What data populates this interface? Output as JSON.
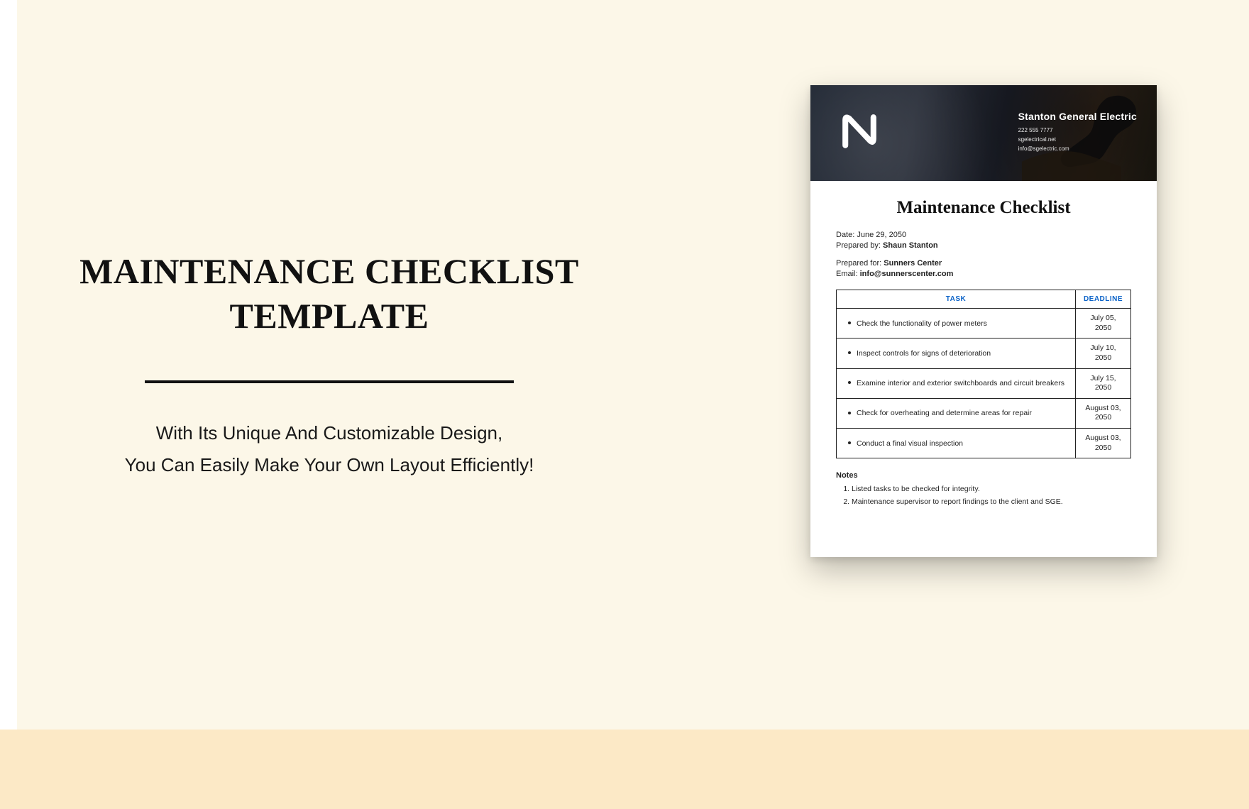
{
  "left": {
    "title_line1": "MAINTENANCE CHECKLIST",
    "title_line2": "TEMPLATE",
    "subtitle_line1": "With Its Unique And Customizable Design,",
    "subtitle_line2": "You Can Easily Make Your Own Layout Efficiently!"
  },
  "doc": {
    "company": {
      "name": "Stanton General Electric",
      "phone": "222 555 7777",
      "website": "sgelectrical.net",
      "email": "info@sgelectric.com"
    },
    "title": "Maintenance Checklist",
    "date_label": "Date:",
    "date_value": "June 29, 2050",
    "prepared_by_label": "Prepared by:",
    "prepared_by_value": "Shaun Stanton",
    "prepared_for_label": "Prepared for:",
    "prepared_for_value": "Sunners Center",
    "email_label": "Email:",
    "email_value": "info@sunnerscenter.com",
    "table": {
      "task_header": "TASK",
      "deadline_header": "DEADLINE",
      "rows": [
        {
          "task": "Check the functionality of power meters",
          "deadline": "July 05, 2050"
        },
        {
          "task": "Inspect controls for signs of deterioration",
          "deadline": "July 10, 2050"
        },
        {
          "task": "Examine interior and exterior switchboards and circuit breakers",
          "deadline": "July 15, 2050"
        },
        {
          "task": "Check for overheating and determine areas for repair",
          "deadline": "August 03, 2050"
        },
        {
          "task": "Conduct a final visual inspection",
          "deadline": "August 03, 2050"
        }
      ]
    },
    "notes_header": "Notes",
    "notes": [
      "Listed tasks to be checked for integrity.",
      "Maintenance supervisor to report findings to the client and SGE."
    ]
  }
}
